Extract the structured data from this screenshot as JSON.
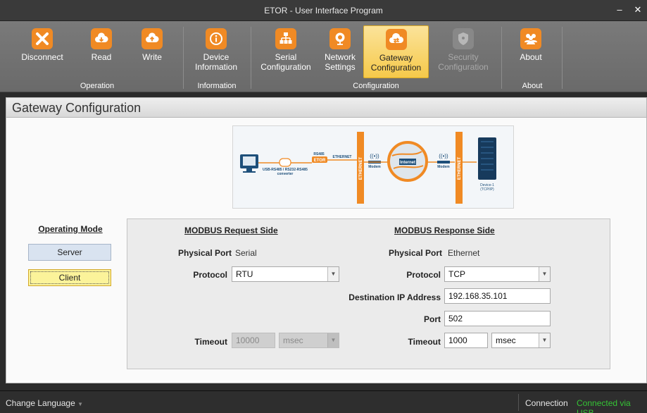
{
  "window": {
    "title": "ETOR - User Interface Program"
  },
  "ribbon": {
    "buttons": {
      "disconnect": "Disconnect",
      "read": "Read",
      "write": "Write",
      "device_info_1": "Device",
      "device_info_2": "Information",
      "serial_1": "Serial",
      "serial_2": "Configuration",
      "network_1": "Network",
      "network_2": "Settings",
      "gateway_1": "Gateway",
      "gateway_2": "Configuration",
      "security_1": "Security",
      "security_2": "Configuration",
      "about": "About"
    },
    "groups": {
      "operation": "Operation",
      "information": "Information",
      "configuration": "Configuration",
      "about": "About"
    }
  },
  "page": {
    "title": "Gateway Configuration"
  },
  "diagram": {
    "usb": "USB-RS485 / RS232-RS485",
    "converter": "converter",
    "rs485": "RS485",
    "etor": "ETOR",
    "ethernet": "ETHERNET",
    "ethernet_bar": "ETHERNET",
    "modem": "Modem",
    "internet": "Internet",
    "device": "Device-1",
    "tcpip": "(TCP/IP)"
  },
  "operating_mode": {
    "title": "Operating Mode",
    "server": "Server",
    "client": "Client",
    "selected": "Client"
  },
  "request_side": {
    "title": "MODBUS Request Side",
    "physical_port_label": "Physical Port",
    "physical_port_value": "Serial",
    "protocol_label": "Protocol",
    "protocol_value": "RTU",
    "timeout_label": "Timeout",
    "timeout_value": "10000",
    "timeout_unit": "msec"
  },
  "response_side": {
    "title": "MODBUS Response Side",
    "physical_port_label": "Physical Port",
    "physical_port_value": "Ethernet",
    "protocol_label": "Protocol",
    "protocol_value": "TCP",
    "dest_ip_label": "Destination IP Address",
    "dest_ip_value": "192.168.35.101",
    "port_label": "Port",
    "port_value": "502",
    "timeout_label": "Timeout",
    "timeout_value": "1000",
    "timeout_unit": "msec"
  },
  "status": {
    "change_language": "Change Language",
    "connection_label": "Connection",
    "connection_value": "Connected via USB",
    "connection_color": "#35c435"
  },
  "colors": {
    "accent_orange": "#f08a24",
    "active_yellow": "#f6c94a"
  }
}
